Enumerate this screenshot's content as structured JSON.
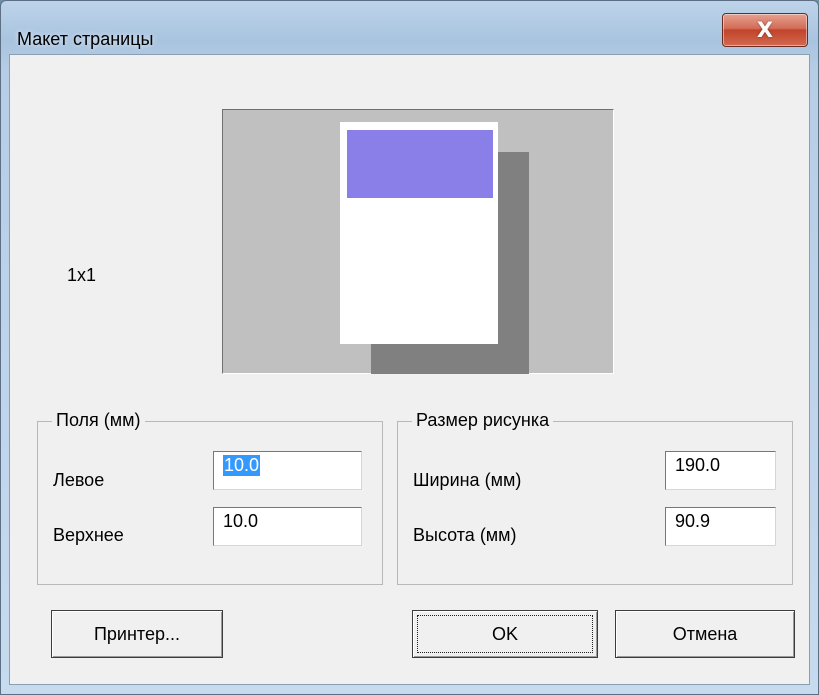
{
  "window": {
    "title": "Макет страницы",
    "close_icon": "close-icon",
    "close_glyph": "X"
  },
  "layout_label": "1x1",
  "margins_group": {
    "title": "Поля (мм)",
    "left_label": "Левое",
    "left_value": "10.0",
    "top_label": "Верхнее",
    "top_value": "10.0"
  },
  "size_group": {
    "title": "Размер рисунка",
    "width_label": "Ширина (мм)",
    "width_value": "190.0",
    "height_label": "Высота (мм)",
    "height_value": "90.9"
  },
  "buttons": {
    "printer": "Принтер...",
    "ok": "OK",
    "cancel": "Отмена"
  },
  "colors": {
    "print_area": "#8a7fe8",
    "preview_background": "#c0c0c0",
    "page_shadow": "#808080",
    "selection": "#3399ff"
  }
}
